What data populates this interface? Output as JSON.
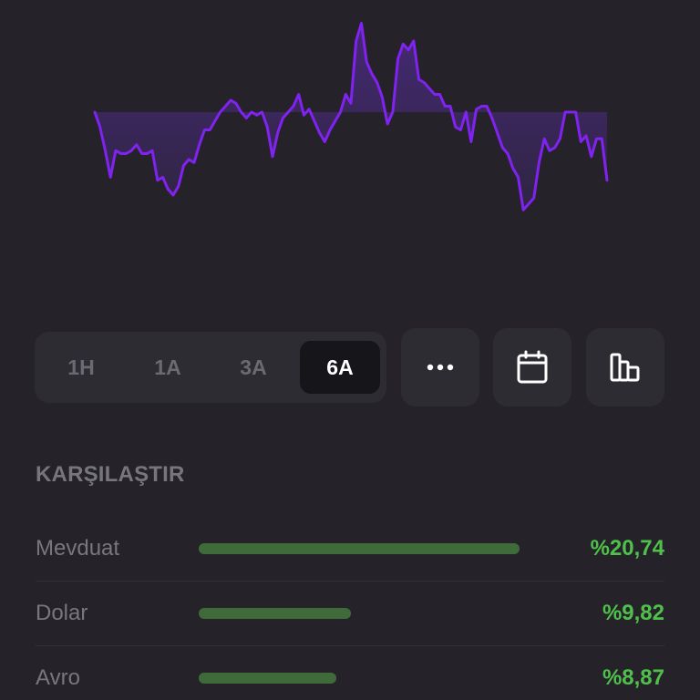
{
  "chart_data": {
    "type": "area",
    "baseline": 0,
    "values": [
      0.0,
      -0.5,
      -1.3,
      -2.2,
      -1.3,
      -1.4,
      -1.4,
      -1.3,
      -1.1,
      -1.4,
      -1.4,
      -1.3,
      -2.3,
      -2.2,
      -2.6,
      -2.8,
      -2.5,
      -1.8,
      -1.6,
      -1.7,
      -1.1,
      -0.6,
      -0.6,
      -0.3,
      0.0,
      0.2,
      0.4,
      0.3,
      0.0,
      -0.2,
      0.0,
      -0.1,
      0.0,
      -0.5,
      -1.5,
      -0.7,
      -0.2,
      0.0,
      0.2,
      0.6,
      -0.1,
      0.1,
      -0.3,
      -0.7,
      -1.0,
      -0.6,
      -0.3,
      0.0,
      0.6,
      0.3,
      2.4,
      3.0,
      1.7,
      1.3,
      1.0,
      0.5,
      -0.4,
      0.0,
      1.8,
      2.3,
      2.1,
      2.4,
      1.1,
      1.0,
      0.8,
      0.6,
      0.6,
      0.2,
      0.2,
      -0.5,
      -0.6,
      0.0,
      -1.0,
      0.1,
      0.2,
      0.2,
      -0.2,
      -0.7,
      -1.2,
      -1.4,
      -1.9,
      -2.2,
      -3.3,
      -3.1,
      -2.9,
      -1.7,
      -0.9,
      -1.3,
      -1.2,
      -0.9,
      0.0,
      0.0,
      0.0,
      -1.0,
      -0.8,
      -1.5,
      -0.9,
      -0.9,
      -2.3
    ],
    "colors": {
      "line": "#8022f0",
      "fill_top": "#4b2a82",
      "fill_bottom": "#302545"
    }
  },
  "period_selector": {
    "options": [
      "1H",
      "1A",
      "3A",
      "6A"
    ],
    "active": "6A"
  },
  "toolbar": {
    "more_icon": "more-horizontal-icon",
    "calendar_icon": "calendar-icon",
    "compare_icon": "bar-chart-icon"
  },
  "compare": {
    "title": "KARŞILAŞTIR",
    "max_value": 20.74,
    "items": [
      {
        "label": "Mevduat",
        "value_text": "%20,74",
        "value": 20.74
      },
      {
        "label": "Dolar",
        "value_text": "%9,82",
        "value": 9.82
      },
      {
        "label": "Avro",
        "value_text": "%8,87",
        "value": 8.87
      }
    ],
    "colors": {
      "bar": "#3f6b3b",
      "value": "#4fc14b"
    }
  }
}
